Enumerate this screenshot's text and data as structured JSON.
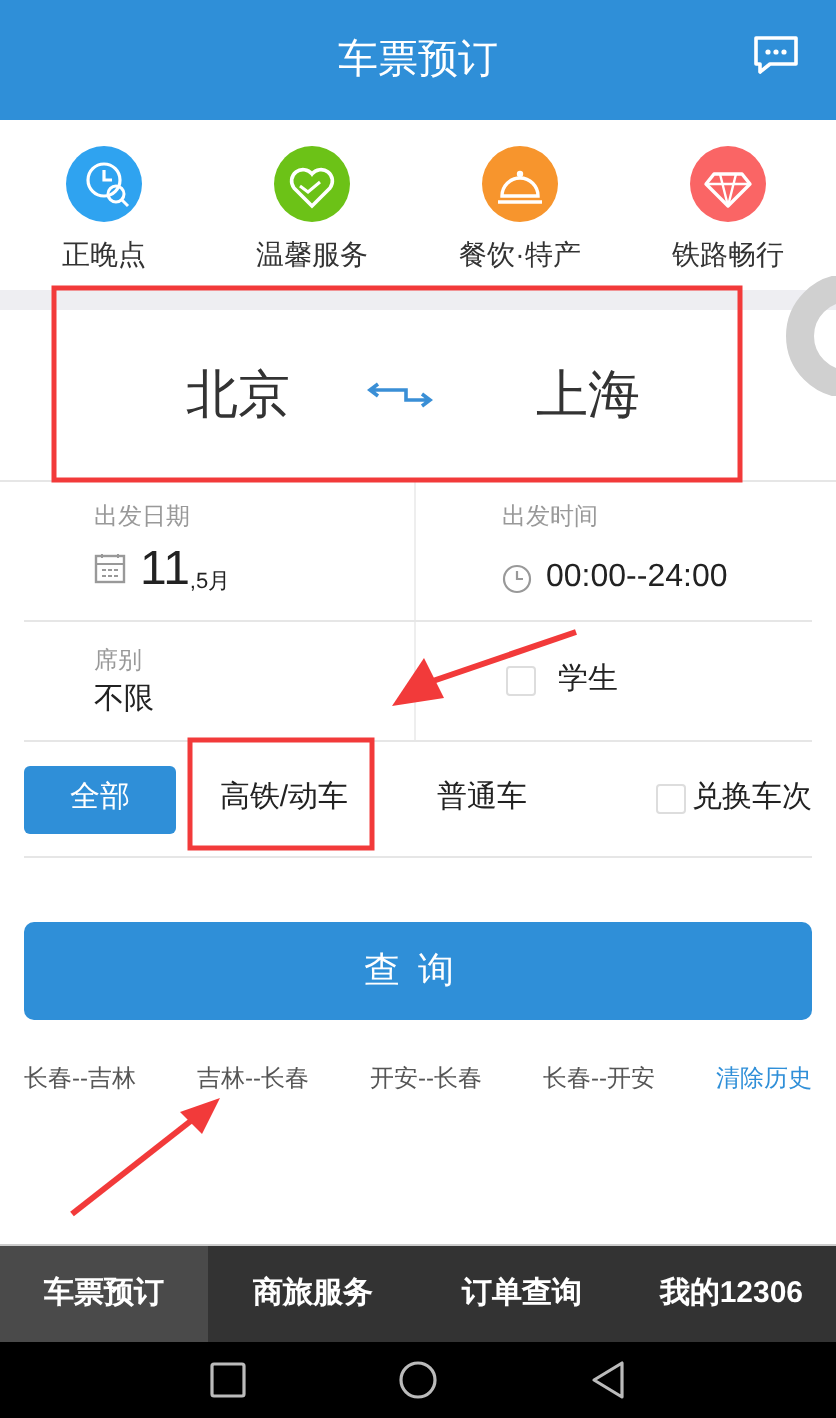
{
  "header": {
    "title": "车票预订"
  },
  "shortcuts": [
    {
      "label": "正晚点",
      "color": "#2fa3f0",
      "kind": "clock"
    },
    {
      "label": "温馨服务",
      "color": "#6cc217",
      "kind": "heart"
    },
    {
      "label": "餐饮·特产",
      "color": "#f7952d",
      "kind": "dish"
    },
    {
      "label": "铁路畅行",
      "color": "#fa6565",
      "kind": "gem"
    }
  ],
  "route": {
    "from": "北京",
    "to": "上海"
  },
  "date": {
    "label": "出发日期",
    "day": "11",
    "month": ",5月"
  },
  "time": {
    "label": "出发时间",
    "value": "00:00--24:00"
  },
  "seat": {
    "label": "席别",
    "value": "不限"
  },
  "student": {
    "label": "学生",
    "checked": false
  },
  "train_types": [
    {
      "label": "全部",
      "selected": true
    },
    {
      "label": "高铁/动车",
      "selected": false
    },
    {
      "label": "普通车",
      "selected": false
    }
  ],
  "exchange": {
    "label": "兑换车次",
    "checked": false
  },
  "search_button": "查询",
  "history": [
    "长春--吉林",
    "吉林--长春",
    "开安--长春",
    "长春--开安"
  ],
  "clear_history": "清除历史",
  "bottom_tabs": [
    {
      "label": "车票预订",
      "selected": true
    },
    {
      "label": "商旅服务",
      "selected": false
    },
    {
      "label": "订单查询",
      "selected": false
    },
    {
      "label": "我的12306",
      "selected": false
    }
  ]
}
